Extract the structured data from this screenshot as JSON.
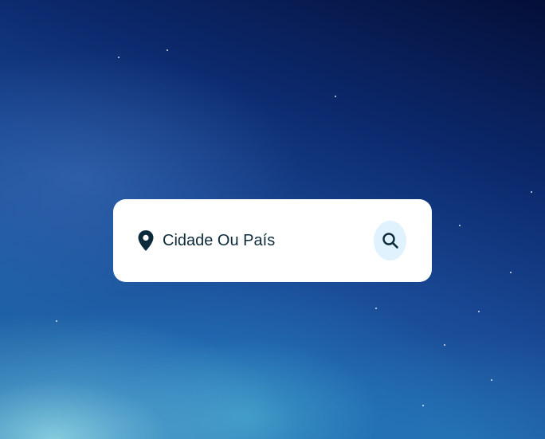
{
  "search": {
    "placeholder": "Cidade Ou País",
    "value": "",
    "location_icon": "map-pin-icon",
    "search_icon": "magnifier-icon"
  },
  "colors": {
    "card_background": "#ffffff",
    "text": "#0d2a3a",
    "button_background": "#dff2fd",
    "icon": "#0d2a3a"
  }
}
